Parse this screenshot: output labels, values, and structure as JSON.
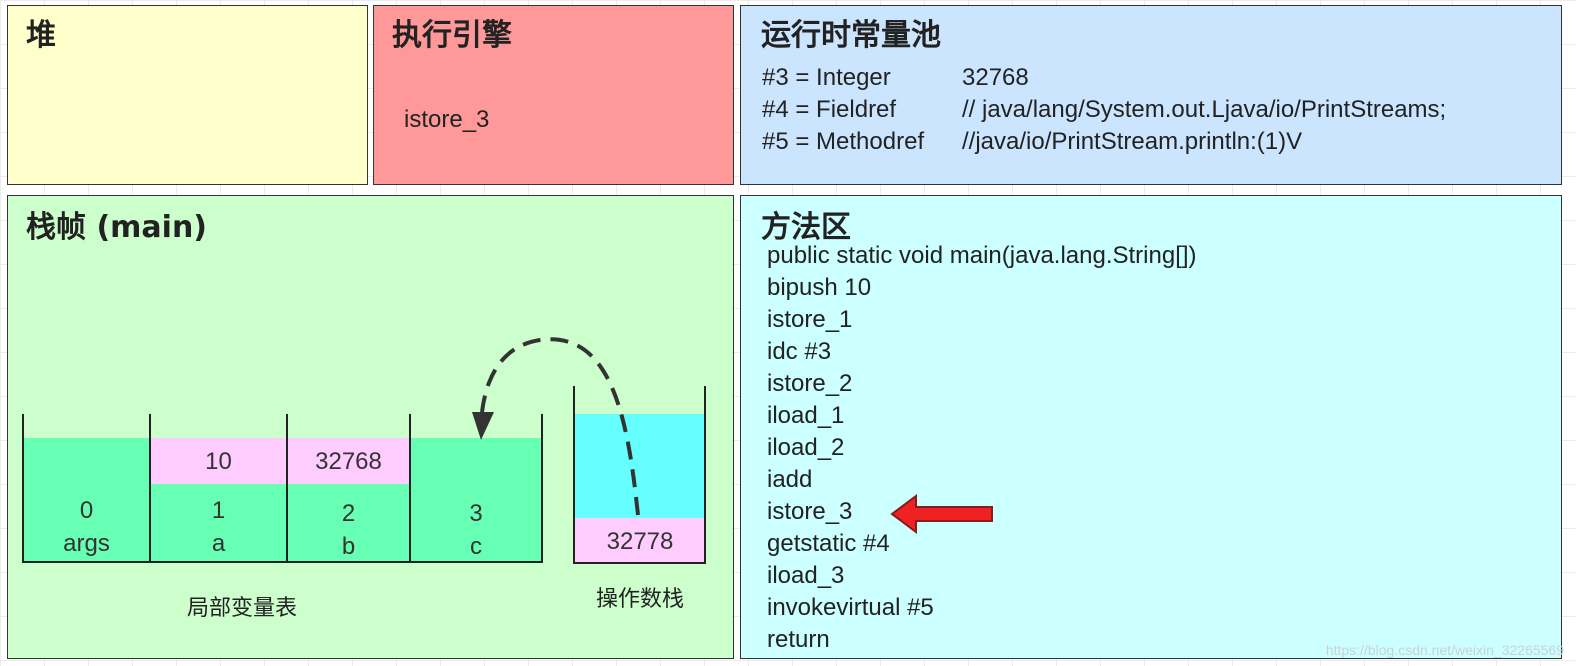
{
  "heap": {
    "title": "堆"
  },
  "engine": {
    "title": "执行引擎",
    "instruction": "istore_3"
  },
  "constant_pool": {
    "title": "运行时常量池",
    "entries": [
      {
        "key": "#3 = Integer",
        "value": "32768"
      },
      {
        "key": "#4 = Fieldref",
        "value": "// java/lang/System.out.Ljava/io/PrintStreams;"
      },
      {
        "key": "#5 = Methodref",
        "value": "//java/io/PrintStream.println:(1)V"
      }
    ]
  },
  "stack_frame": {
    "title": "栈帧 (main)",
    "local_vars": {
      "label": "局部变量表",
      "slots": [
        {
          "index": "0",
          "name": "args",
          "value": ""
        },
        {
          "index": "1",
          "name": "a",
          "value": "10"
        },
        {
          "index": "2",
          "name": "b",
          "value": "32768"
        },
        {
          "index": "3",
          "name": "c",
          "value": ""
        }
      ]
    },
    "operand_stack": {
      "label": "操作数栈",
      "values": [
        "32778"
      ]
    }
  },
  "method_area": {
    "title": "方法区",
    "signature": "public static void main(java.lang.String[])",
    "instructions": [
      "bipush 10",
      "istore_1",
      "idc #3",
      "istore_2",
      "iload_1",
      "iload_2",
      "iadd",
      "istore_3",
      "getstatic #4",
      "iload_3",
      "invokevirtual #5",
      "return"
    ],
    "current_instruction": "istore_3"
  },
  "colors": {
    "heap": "#ffffcc",
    "engine": "#ff9999",
    "pool": "#cce5ff",
    "frame": "#ccffcc",
    "method": "#ccffff",
    "slot": "#66ffb3",
    "slot_value": "#ffccff",
    "stack_top": "#66ffff",
    "pointer": "#ee2222"
  },
  "watermark": "https://blog.csdn.net/weixin_32265569"
}
